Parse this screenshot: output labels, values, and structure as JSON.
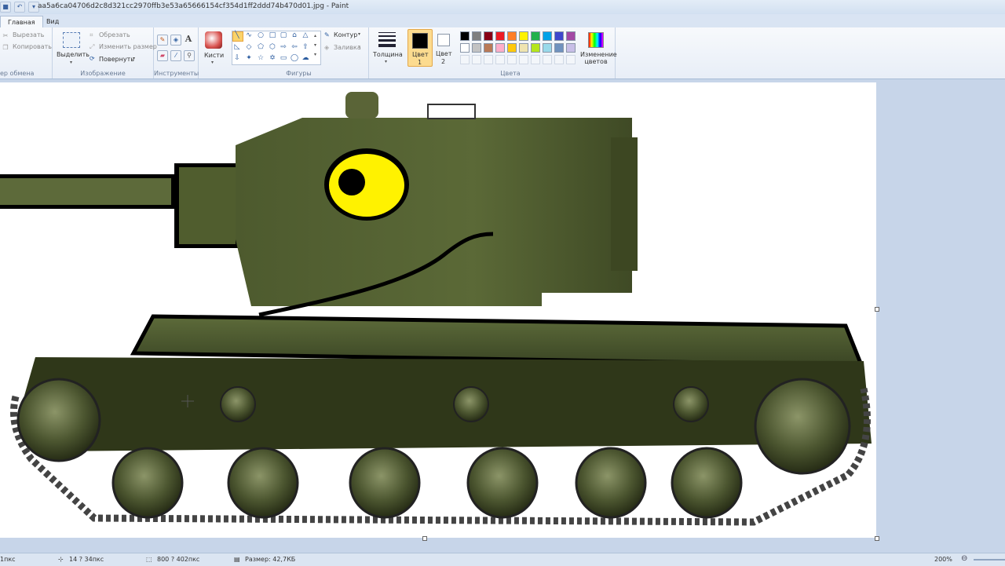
{
  "window": {
    "title": "aa5a6ca04706d2c8d321cc2970ffb3e53a65666154cf354d1ff2ddd74b470d01.jpg - Paint"
  },
  "tabs": [
    {
      "label": "Главная",
      "active": true
    },
    {
      "label": "Вид",
      "active": false
    }
  ],
  "clipboard": {
    "cut": "Вырезать",
    "copy": "Копировать",
    "group_label": "ер обмена"
  },
  "image": {
    "select": "Выделить",
    "crop": "Обрезать",
    "resize": "Изменить размер",
    "rotate": "Повернуть",
    "group_label": "Изображение"
  },
  "tools": {
    "group_label": "Инструменты",
    "text_tool": "A"
  },
  "brushes": {
    "label": "Кисти"
  },
  "shapes": {
    "outline": "Контур",
    "fill": "Заливка",
    "group_label": "Фигуры"
  },
  "thickness": {
    "label": "Толщина"
  },
  "colors": {
    "color1": "Цвет",
    "color1_num": "1",
    "color2": "Цвет",
    "color2_num": "2",
    "group_label": "Цвета",
    "edit": "Изменение цветов",
    "palette_row1": [
      "#000000",
      "#7f7f7f",
      "#880015",
      "#ed1c24",
      "#ff7f27",
      "#fff200",
      "#22b14c",
      "#00a2e8",
      "#3f48cc",
      "#a349a4"
    ],
    "palette_row2": [
      "#ffffff",
      "#c3c3c3",
      "#b97a57",
      "#ffaec9",
      "#ffc90e",
      "#efe4b0",
      "#b5e61d",
      "#99d9ea",
      "#7092be",
      "#c8bfe7"
    ],
    "primary": "#000000",
    "secondary": "#ffffff"
  },
  "status": {
    "left": "1пкс",
    "cursor_pos": "14 ? 34пкс",
    "selection": "800 ? 402пкс",
    "file_size": "Размер: 42,7КБ",
    "zoom": "200%"
  }
}
